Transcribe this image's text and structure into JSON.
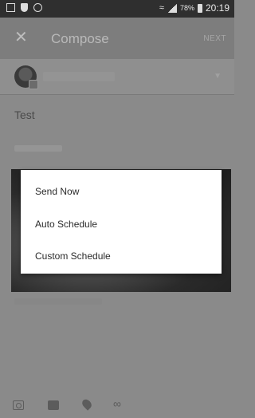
{
  "status_bar": {
    "battery_percent": "78%",
    "time": "20:19"
  },
  "app_bar": {
    "close_icon": "close-icon",
    "title": "Compose",
    "next_label": "NEXT"
  },
  "compose": {
    "text": "Test"
  },
  "popup_menu": {
    "items": [
      {
        "label": "Send Now"
      },
      {
        "label": "Auto Schedule"
      },
      {
        "label": "Custom Schedule"
      }
    ]
  },
  "toolbar": {
    "icons": [
      "camera-icon",
      "gallery-icon",
      "location-icon",
      "link-icon"
    ]
  }
}
